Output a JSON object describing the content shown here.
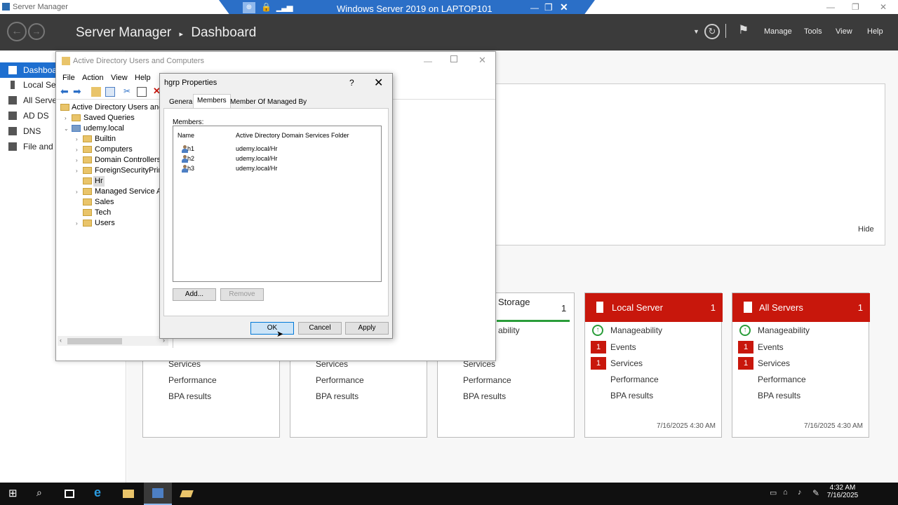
{
  "rdp_bar": {
    "title": "Windows Server 2019 on LAPTOP101"
  },
  "server_manager": {
    "window_title": "Server Manager",
    "header": {
      "app": "Server Manager",
      "page": "Dashboard",
      "menu": [
        "Manage",
        "Tools",
        "View",
        "Help"
      ]
    },
    "left_nav": [
      {
        "label": "Dashboard",
        "selected": true
      },
      {
        "label": "Local Server"
      },
      {
        "label": "All Servers"
      },
      {
        "label": "AD DS"
      },
      {
        "label": "DNS"
      },
      {
        "label": "File and Storage Services"
      }
    ],
    "hide_link": "Hide",
    "tiles": [
      {
        "name": "",
        "count": "",
        "rows": [
          "Services",
          "Performance",
          "BPA results"
        ]
      },
      {
        "name": "",
        "count": "",
        "rows": [
          "Services",
          "Performance",
          "BPA results"
        ]
      },
      {
        "name": "Storage",
        "count": "1",
        "rows": [
          "ability",
          "Services",
          "Performance",
          "BPA results"
        ]
      },
      {
        "name": "Local Server",
        "count": "1",
        "rows": [
          "Manageability",
          "Events",
          "Services",
          "Performance",
          "BPA results"
        ],
        "badges": [
          "1",
          "1"
        ],
        "timestamp": "7/16/2025 4:30 AM"
      },
      {
        "name": "All Servers",
        "count": "1",
        "rows": [
          "Manageability",
          "Events",
          "Services",
          "Performance",
          "BPA results"
        ],
        "badges": [
          "1",
          "1"
        ],
        "timestamp": "7/16/2025 4:30 AM"
      }
    ],
    "accent_color": "#c8170c"
  },
  "aduc": {
    "title": "Active Directory Users and Computers",
    "menu": [
      "File",
      "Action",
      "View",
      "Help"
    ],
    "tree": {
      "root": "Active Directory Users and Co",
      "saved_queries": "Saved Queries",
      "domain": "udemy.local",
      "children": [
        "Builtin",
        "Computers",
        "Domain Controllers",
        "ForeignSecurityPrincip",
        "Hr",
        "Managed Service Acco",
        "Sales",
        "Tech",
        "Users"
      ]
    }
  },
  "dialog": {
    "title": "hgrp Properties",
    "help": "?",
    "tabs": [
      "General",
      "Members",
      "Member Of",
      "Managed By"
    ],
    "members_label": "Members:",
    "columns": [
      "Name",
      "Active Directory Domain Services Folder"
    ],
    "members": [
      {
        "name": "h1",
        "folder": "udemy.local/Hr"
      },
      {
        "name": "h2",
        "folder": "udemy.local/Hr"
      },
      {
        "name": "h3",
        "folder": "udemy.local/Hr"
      }
    ],
    "add": "Add...",
    "remove": "Remove",
    "ok": "OK",
    "cancel": "Cancel",
    "apply": "Apply"
  },
  "taskbar": {
    "time": "4:32 AM",
    "date": "7/16/2025"
  }
}
